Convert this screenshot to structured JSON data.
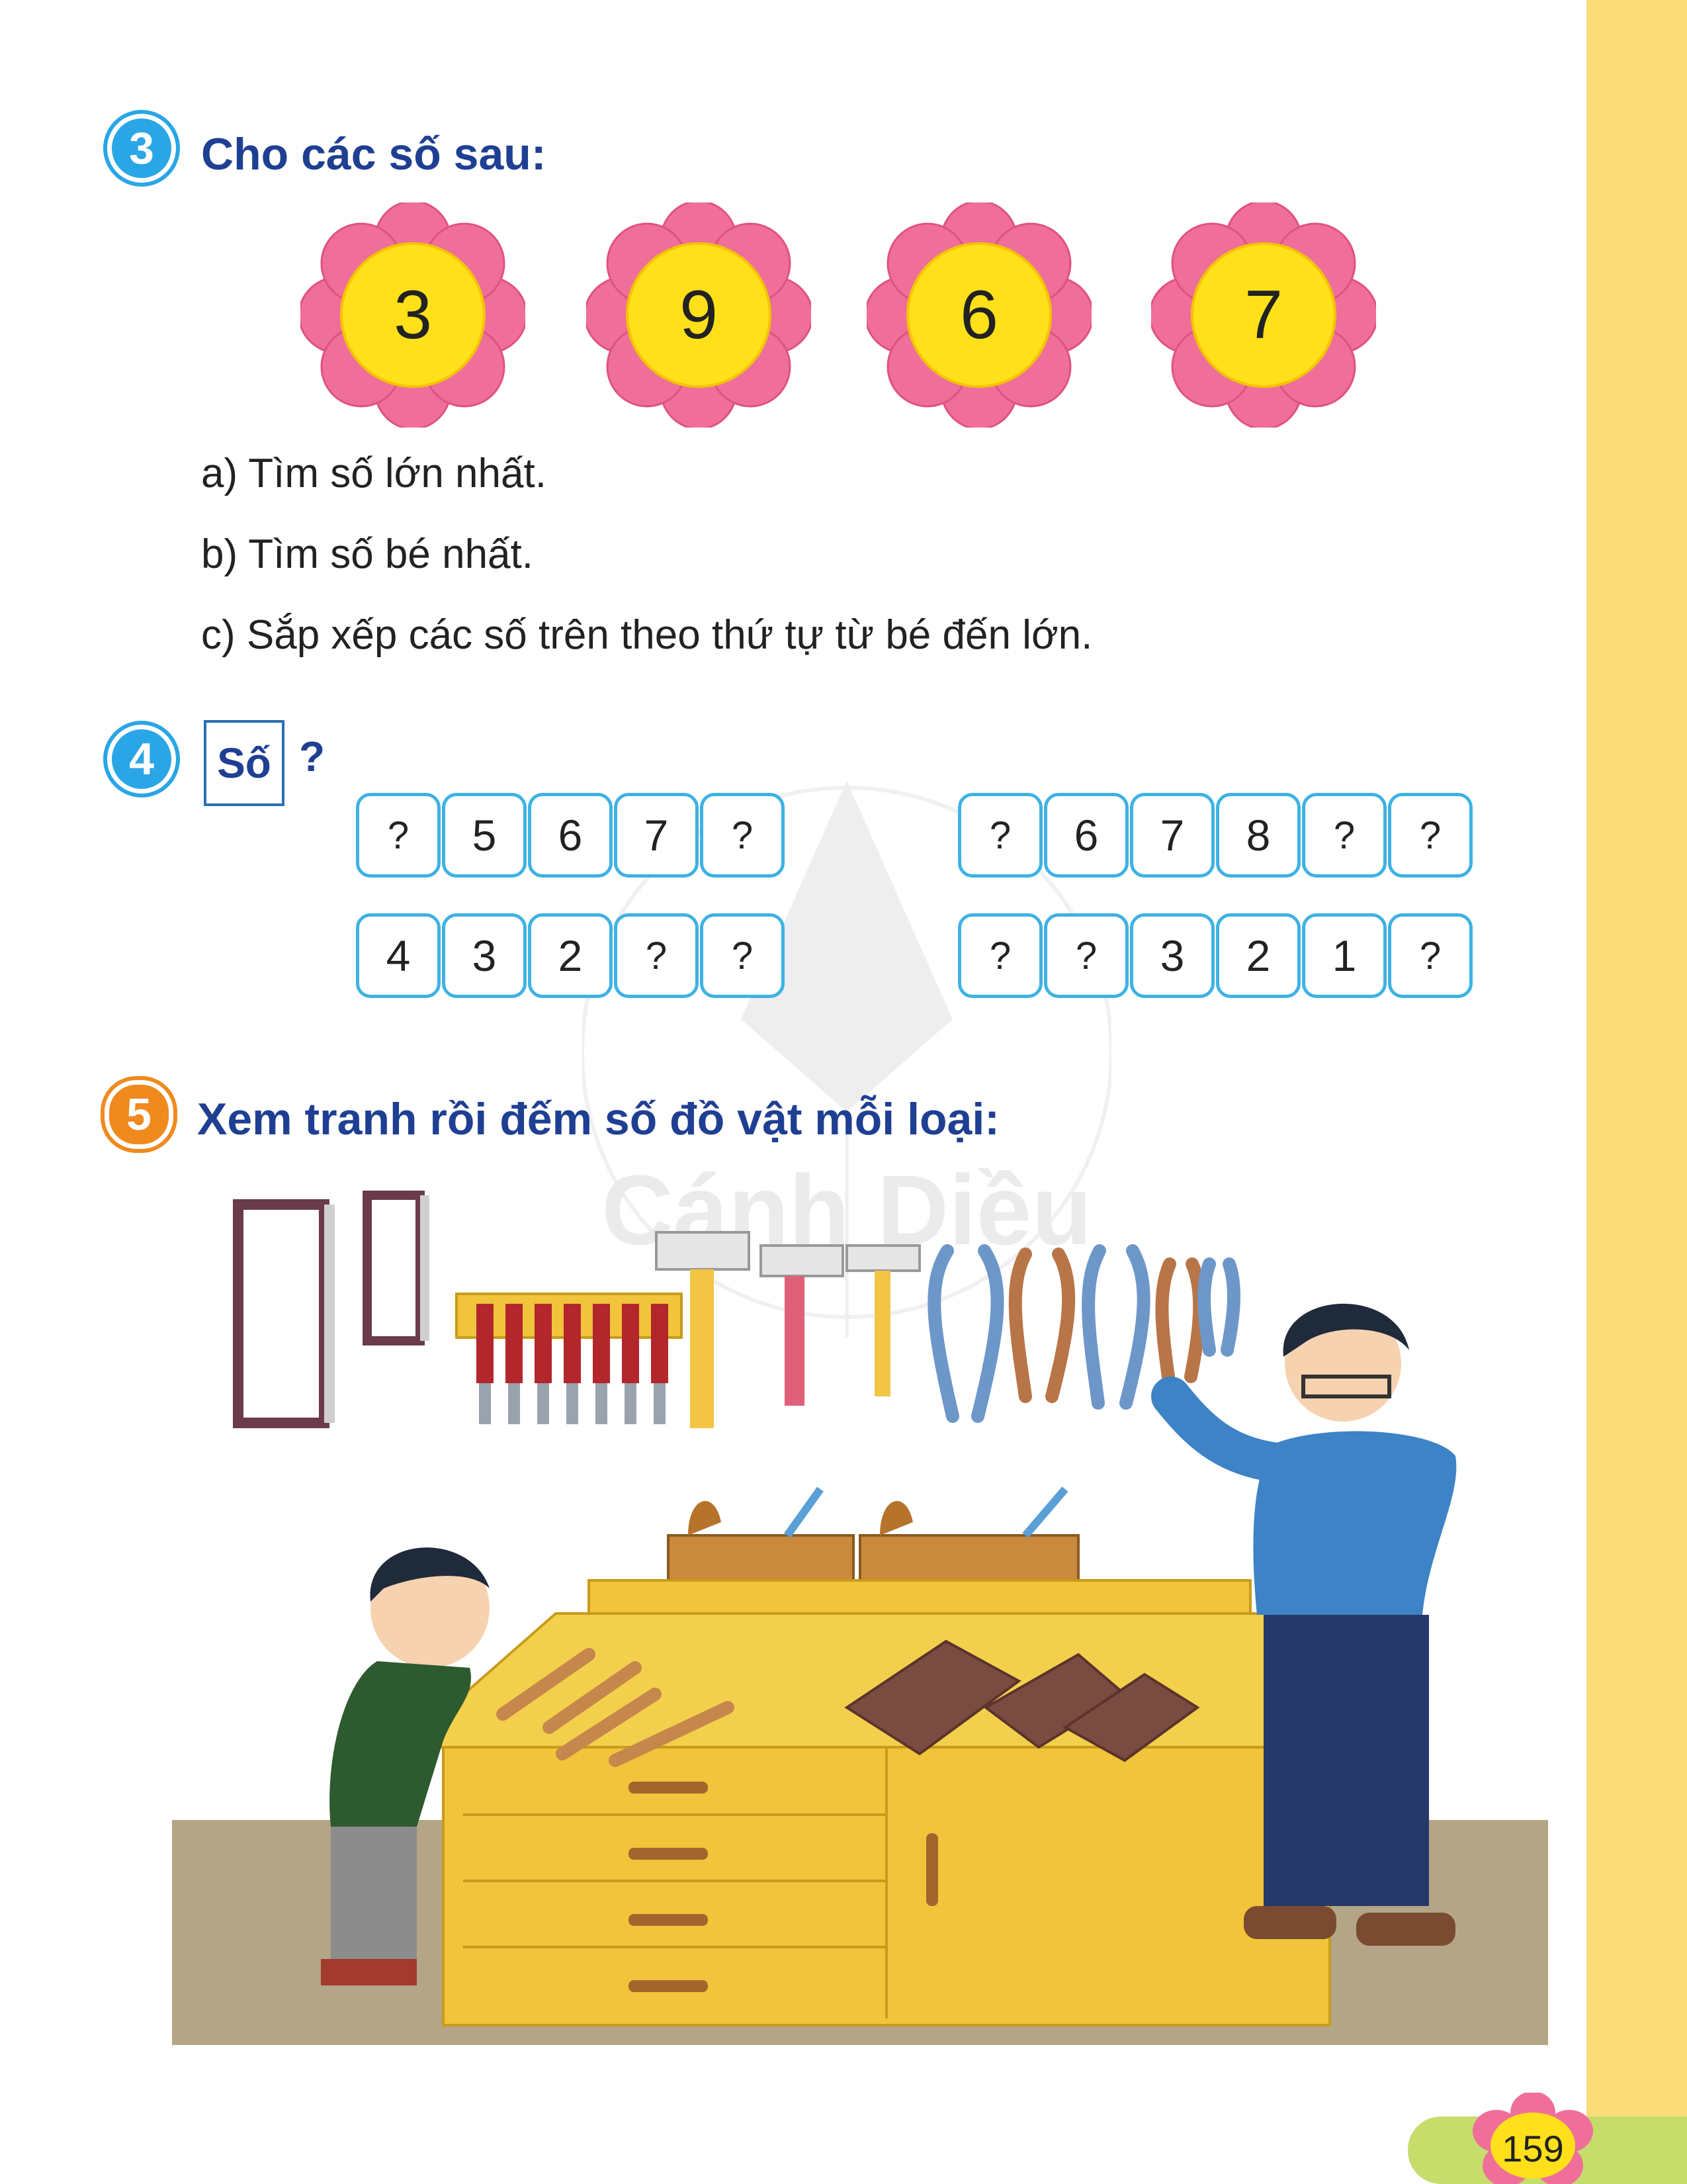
{
  "q3": {
    "number": "3",
    "title": "Cho các số sau:",
    "flowers": [
      "3",
      "9",
      "6",
      "7"
    ],
    "a": "a) Tìm số lớn nhất.",
    "b": "b) Tìm số bé nhất.",
    "c": "c) Sắp xếp các số trên theo thứ tự từ bé đến lớn."
  },
  "q4": {
    "number": "4",
    "box_label": "Số",
    "question_mark": "?",
    "rows": [
      [
        "?",
        "5",
        "6",
        "7",
        "?"
      ],
      [
        "?",
        "6",
        "7",
        "8",
        "?",
        "?"
      ],
      [
        "4",
        "3",
        "2",
        "?",
        "?"
      ],
      [
        "?",
        "?",
        "3",
        "2",
        "1",
        "?"
      ]
    ]
  },
  "q5": {
    "number": "5",
    "title": "Xem tranh rồi đếm số đồ vật mỗi loại:"
  },
  "watermark": "Cánh Diều",
  "page_number": "159",
  "colors": {
    "heading_blue": "#1f3f93",
    "badge_blue": "#2aa6e6",
    "badge_orange": "#f08a1e",
    "petal_pink": "#ef6f9a",
    "flower_center": "#ffe01a",
    "sidebar": "#fbdc78",
    "cell_border": "#3fb2e3"
  }
}
